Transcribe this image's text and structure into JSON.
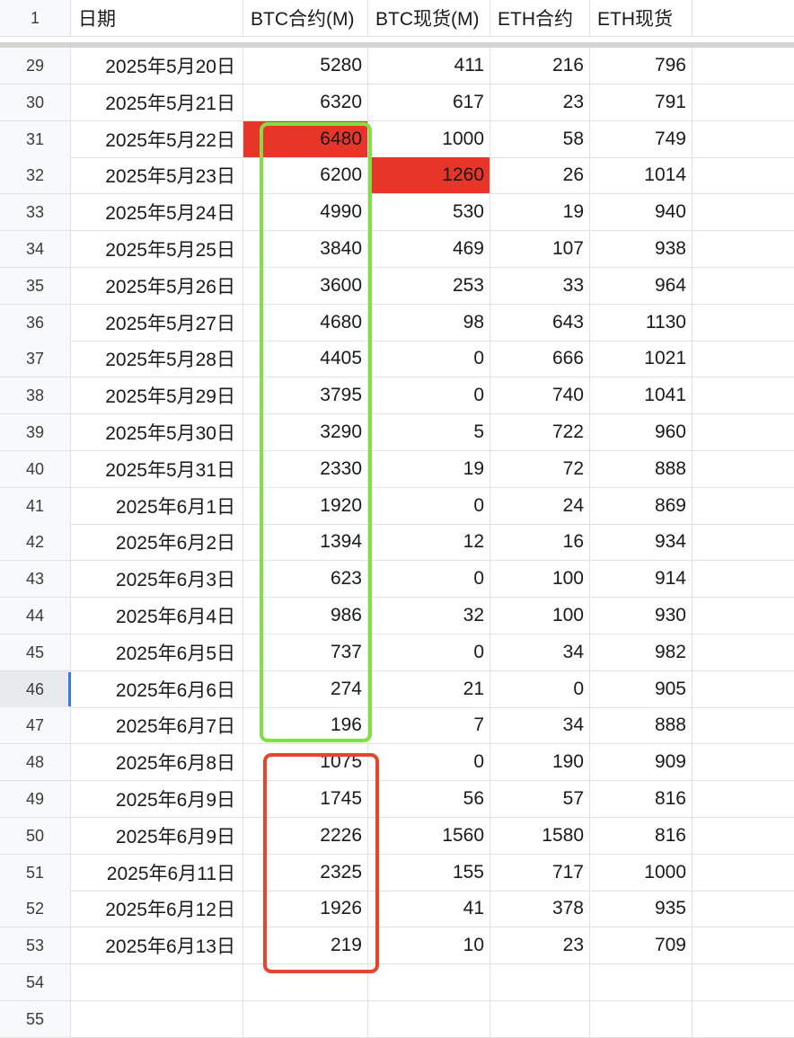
{
  "header": {
    "row_number": "1",
    "columns": [
      "日期",
      "BTC合约(M)",
      "BTC现货(M)",
      "ETH合约",
      "ETH现货"
    ]
  },
  "rows": [
    {
      "num": "29",
      "date": "2025年5月20日",
      "btc_futures": "5280",
      "btc_spot": "411",
      "eth_futures": "216",
      "eth_spot": "796"
    },
    {
      "num": "30",
      "date": "2025年5月21日",
      "btc_futures": "6320",
      "btc_spot": "617",
      "eth_futures": "23",
      "eth_spot": "791"
    },
    {
      "num": "31",
      "date": "2025年5月22日",
      "btc_futures": "6480",
      "btc_spot": "1000",
      "eth_futures": "58",
      "eth_spot": "749"
    },
    {
      "num": "32",
      "date": "2025年5月23日",
      "btc_futures": "6200",
      "btc_spot": "1260",
      "eth_futures": "26",
      "eth_spot": "1014"
    },
    {
      "num": "33",
      "date": "2025年5月24日",
      "btc_futures": "4990",
      "btc_spot": "530",
      "eth_futures": "19",
      "eth_spot": "940"
    },
    {
      "num": "34",
      "date": "2025年5月25日",
      "btc_futures": "3840",
      "btc_spot": "469",
      "eth_futures": "107",
      "eth_spot": "938"
    },
    {
      "num": "35",
      "date": "2025年5月26日",
      "btc_futures": "3600",
      "btc_spot": "253",
      "eth_futures": "33",
      "eth_spot": "964"
    },
    {
      "num": "36",
      "date": "2025年5月27日",
      "btc_futures": "4680",
      "btc_spot": "98",
      "eth_futures": "643",
      "eth_spot": "1130"
    },
    {
      "num": "37",
      "date": "2025年5月28日",
      "btc_futures": "4405",
      "btc_spot": "0",
      "eth_futures": "666",
      "eth_spot": "1021"
    },
    {
      "num": "38",
      "date": "2025年5月29日",
      "btc_futures": "3795",
      "btc_spot": "0",
      "eth_futures": "740",
      "eth_spot": "1041"
    },
    {
      "num": "39",
      "date": "2025年5月30日",
      "btc_futures": "3290",
      "btc_spot": "5",
      "eth_futures": "722",
      "eth_spot": "960"
    },
    {
      "num": "40",
      "date": "2025年5月31日",
      "btc_futures": "2330",
      "btc_spot": "19",
      "eth_futures": "72",
      "eth_spot": "888"
    },
    {
      "num": "41",
      "date": "2025年6月1日",
      "btc_futures": "1920",
      "btc_spot": "0",
      "eth_futures": "24",
      "eth_spot": "869"
    },
    {
      "num": "42",
      "date": "2025年6月2日",
      "btc_futures": "1394",
      "btc_spot": "12",
      "eth_futures": "16",
      "eth_spot": "934"
    },
    {
      "num": "43",
      "date": "2025年6月3日",
      "btc_futures": "623",
      "btc_spot": "0",
      "eth_futures": "100",
      "eth_spot": "914"
    },
    {
      "num": "44",
      "date": "2025年6月4日",
      "btc_futures": "986",
      "btc_spot": "32",
      "eth_futures": "100",
      "eth_spot": "930"
    },
    {
      "num": "45",
      "date": "2025年6月5日",
      "btc_futures": "737",
      "btc_spot": "0",
      "eth_futures": "34",
      "eth_spot": "982"
    },
    {
      "num": "46",
      "date": "2025年6月6日",
      "btc_futures": "274",
      "btc_spot": "21",
      "eth_futures": "0",
      "eth_spot": "905"
    },
    {
      "num": "47",
      "date": "2025年6月7日",
      "btc_futures": "196",
      "btc_spot": "7",
      "eth_futures": "34",
      "eth_spot": "888"
    },
    {
      "num": "48",
      "date": "2025年6月8日",
      "btc_futures": "1075",
      "btc_spot": "0",
      "eth_futures": "190",
      "eth_spot": "909"
    },
    {
      "num": "49",
      "date": "2025年6月9日",
      "btc_futures": "1745",
      "btc_spot": "56",
      "eth_futures": "57",
      "eth_spot": "816"
    },
    {
      "num": "50",
      "date": "2025年6月9日",
      "btc_futures": "2226",
      "btc_spot": "1560",
      "eth_futures": "1580",
      "eth_spot": "816"
    },
    {
      "num": "51",
      "date": "2025年6月11日",
      "btc_futures": "2325",
      "btc_spot": "155",
      "eth_futures": "717",
      "eth_spot": "1000"
    },
    {
      "num": "52",
      "date": "2025年6月12日",
      "btc_futures": "1926",
      "btc_spot": "41",
      "eth_futures": "378",
      "eth_spot": "935"
    },
    {
      "num": "53",
      "date": "2025年6月13日",
      "btc_futures": "219",
      "btc_spot": "10",
      "eth_futures": "23",
      "eth_spot": "709"
    },
    {
      "num": "54",
      "date": "",
      "btc_futures": "",
      "btc_spot": "",
      "eth_futures": "",
      "eth_spot": ""
    },
    {
      "num": "55",
      "date": "",
      "btc_futures": "",
      "btc_spot": "",
      "eth_futures": "",
      "eth_spot": ""
    }
  ],
  "highlight_colors": {
    "red_fill": "#e8352a",
    "green_outline": "#7fe043",
    "red_outline": "#e8452e",
    "selection": "#3b78e7"
  },
  "selected_row": "46"
}
